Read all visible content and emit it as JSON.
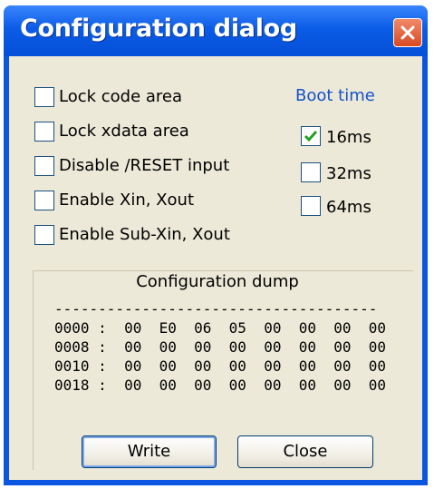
{
  "window": {
    "title": "Configuration dialog",
    "close_icon": "close-x-icon"
  },
  "options": [
    {
      "label": "Lock code area",
      "checked": false
    },
    {
      "label": "Lock xdata area",
      "checked": false
    },
    {
      "label": "Disable /RESET input",
      "checked": false
    },
    {
      "label": "Enable Xin, Xout",
      "checked": false
    },
    {
      "label": "Enable Sub-Xin, Xout",
      "checked": false
    }
  ],
  "boot": {
    "title": "Boot time",
    "options": [
      {
        "label": "16ms",
        "checked": true
      },
      {
        "label": "32ms",
        "checked": false
      },
      {
        "label": "64ms",
        "checked": false
      }
    ]
  },
  "dump": {
    "title": "Configuration dump",
    "separator": "-------------------------------------",
    "rows": [
      "0000 :  00  E0  06  05  00  00  00  00",
      "0008 :  00  00  00  00  00  00  00  00",
      "0010 :  00  00  00  00  00  00  00  00",
      "0018 :  00  00  00  00  00  00  00  00"
    ]
  },
  "buttons": {
    "write": "Write",
    "close": "Close"
  },
  "colors": {
    "titlebar": "#0a56e0",
    "face": "#ece9d8",
    "accent_text": "#1552c9",
    "close": "#d94a22"
  }
}
